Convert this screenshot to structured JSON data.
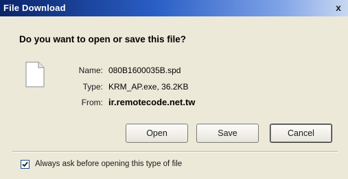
{
  "window": {
    "title": "File Download",
    "close_glyph": "x"
  },
  "prompt": {
    "question": "Do you want to open or save this file?"
  },
  "file": {
    "icon": "generic-file-icon",
    "name_label": "Name:",
    "name_value": "080B1600035B.spd",
    "type_label": "Type:",
    "type_value": "KRM_AP.exe, 36.2KB",
    "from_label": "From:",
    "from_value": "ir.remotecode.net.tw"
  },
  "buttons": {
    "open_label": "Open",
    "save_label": "Save",
    "cancel_label": "Cancel"
  },
  "footer": {
    "checkbox_checked": true,
    "checkbox_label": "Always ask before opening this type of file"
  },
  "colors": {
    "titlebar_start": "#0a246a",
    "titlebar_end": "#c9d8f2",
    "dialog_bg": "#ece9d8"
  }
}
